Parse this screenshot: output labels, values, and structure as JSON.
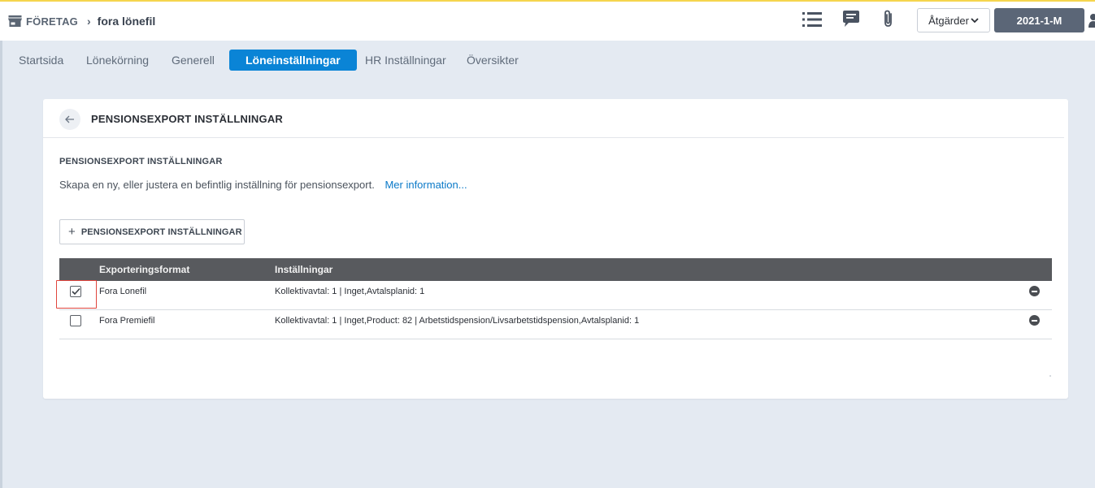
{
  "header": {
    "company_label": "FÖRETAG",
    "current_page": "fora lönefil",
    "actions_label": "Åtgärder",
    "period_label": "2021-1-M",
    "icons": [
      "store-icon",
      "chevron-right-icon",
      "list-icon",
      "comment-icon",
      "paperclip-icon",
      "chevron-down-icon",
      "user-icon"
    ]
  },
  "tabs": [
    {
      "label": "Startsida",
      "active": false
    },
    {
      "label": "Lönekörning",
      "active": false
    },
    {
      "label": "Generell",
      "active": false
    },
    {
      "label": "Löneinställningar",
      "active": true
    },
    {
      "label": "HR Inställningar",
      "active": false
    },
    {
      "label": "Översikter",
      "active": false
    }
  ],
  "card": {
    "title": "PENSIONSEXPORT INSTÄLLNINGAR",
    "section_title": "PENSIONSEXPORT INSTÄLLNINGAR",
    "description": "Skapa en ny, eller justera en befintlig inställning för pensionsexport.",
    "more_info_link": "Mer information...",
    "add_button_label": "PENSIONSEXPORT INSTÄLLNINGAR",
    "table": {
      "columns": [
        "Exporteringsformat",
        "Inställningar"
      ],
      "rows": [
        {
          "checked": true,
          "format": "Fora Lonefil",
          "settings": "Kollektivavtal: 1 | Inget,Avtalsplanid: 1"
        },
        {
          "checked": false,
          "format": "Fora Premiefil",
          "settings": "Kollektivavtal: 1 | Inget,Product: 82 | Arbetstidspension/Livsarbetstidspension,Avtalsplanid: 1"
        }
      ]
    }
  },
  "colors": {
    "accent": "#0a84d6",
    "top_bar": "#f5d54e",
    "table_header": "#585a5e",
    "period_button": "#5b6677",
    "focus_ring": "#e0453d"
  }
}
